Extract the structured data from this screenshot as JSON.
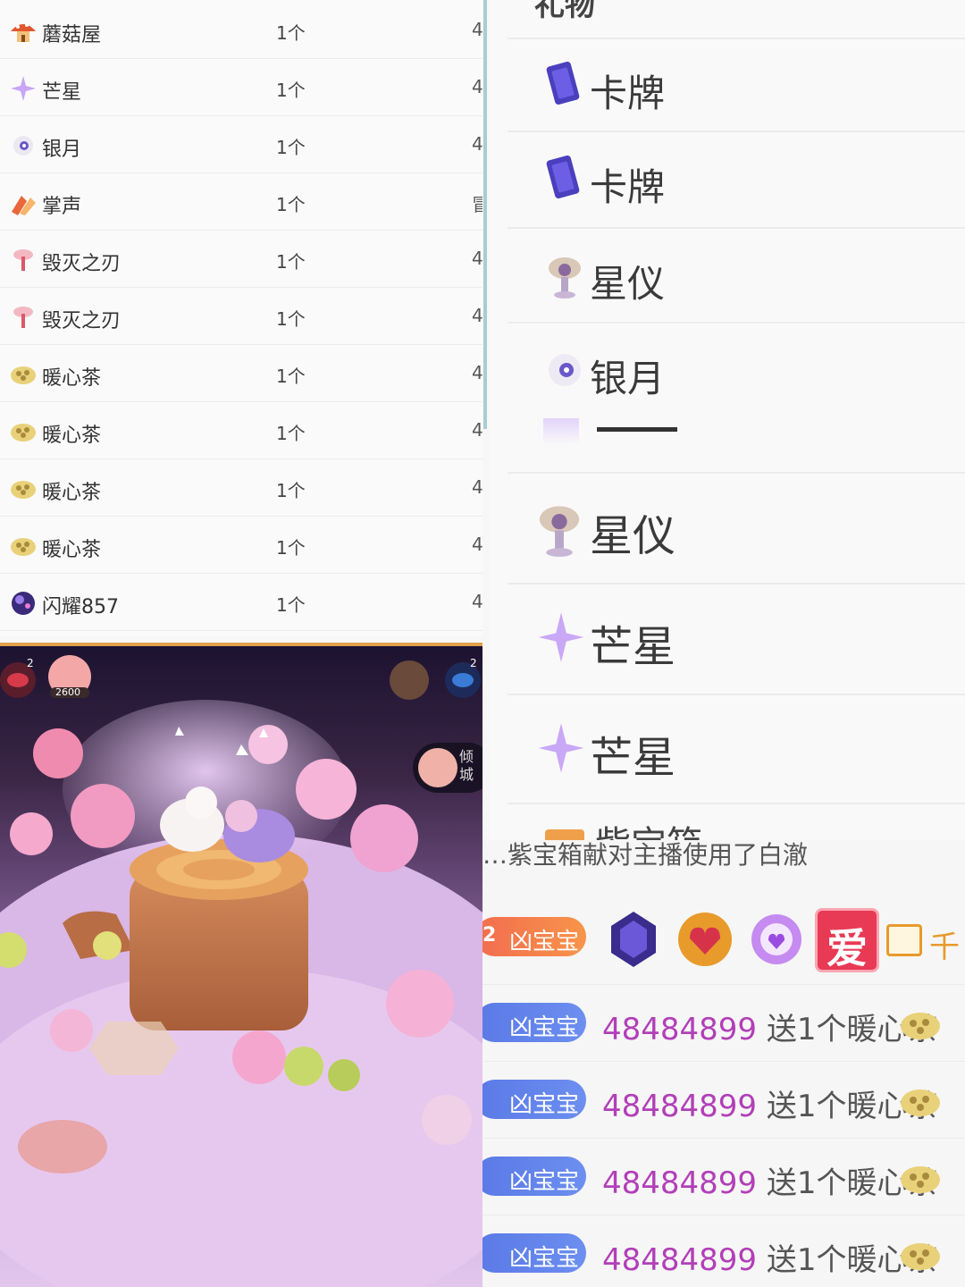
{
  "gift_list": {
    "rows": [
      {
        "name": "蘑菇屋",
        "qty": "1个",
        "extra": "4",
        "icon": "mushroom-house-icon"
      },
      {
        "name": "芒星",
        "qty": "1个",
        "extra": "4",
        "icon": "star-sparkle-icon"
      },
      {
        "name": "银月",
        "qty": "1个",
        "extra": "4",
        "icon": "silver-moon-icon"
      },
      {
        "name": "掌声",
        "qty": "1个",
        "extra": "冒",
        "icon": "applause-icon"
      },
      {
        "name": "毁灭之刃",
        "qty": "1个",
        "extra": "4",
        "icon": "blade-icon"
      },
      {
        "name": "毁灭之刃",
        "qty": "1个",
        "extra": "4",
        "icon": "blade-icon"
      },
      {
        "name": "暖心茶",
        "qty": "1个",
        "extra": "4",
        "icon": "warm-tea-icon"
      },
      {
        "name": "暖心茶",
        "qty": "1个",
        "extra": "4",
        "icon": "warm-tea-icon"
      },
      {
        "name": "暖心茶",
        "qty": "1个",
        "extra": "4",
        "icon": "warm-tea-icon"
      },
      {
        "name": "暖心茶",
        "qty": "1个",
        "extra": "4",
        "icon": "warm-tea-icon"
      },
      {
        "name": "闪耀857",
        "qty": "1个",
        "extra": "4",
        "icon": "shine-orb-icon"
      }
    ]
  },
  "gift_panel": {
    "header": "礼物",
    "items": [
      {
        "name": "卡牌",
        "icon": "card-icon"
      },
      {
        "name": "卡牌",
        "icon": "card-icon"
      },
      {
        "name": "星仪",
        "icon": "star-instrument-icon"
      },
      {
        "name": "银月",
        "icon": "silver-moon-icon"
      },
      {
        "name": "星仪",
        "icon": "star-instrument-icon"
      },
      {
        "name": "芒星",
        "icon": "star-sparkle-icon"
      },
      {
        "name": "芒星",
        "icon": "star-sparkle-icon"
      }
    ],
    "partial_bottom": "紫宝箱"
  },
  "scene": {
    "left_badge_count": "2",
    "score": "2600",
    "right_badge_count": "2",
    "chip_text": "倾城"
  },
  "chat": {
    "notice": "…紫宝箱献对主播使用了白澈",
    "highlight_row": {
      "level": "2",
      "badge": "凶宝宝",
      "trail": "千"
    },
    "messages": [
      {
        "badge": "凶宝宝",
        "uid": "48484899",
        "action": "送1个暖心茶"
      },
      {
        "badge": "凶宝宝",
        "uid": "48484899",
        "action": "送1个暖心茶"
      },
      {
        "badge": "凶宝宝",
        "uid": "48484899",
        "action": "送1个暖心茶"
      },
      {
        "badge": "凶宝宝",
        "uid": "48484899",
        "action": "送1个暖心茶"
      }
    ],
    "ai_label": "爱"
  },
  "colors": {
    "uid": "#b23fb8",
    "badge_orange": "#f26c4f",
    "badge_blue": "#5a79e6",
    "scrollbar": "#a9ccd3"
  }
}
